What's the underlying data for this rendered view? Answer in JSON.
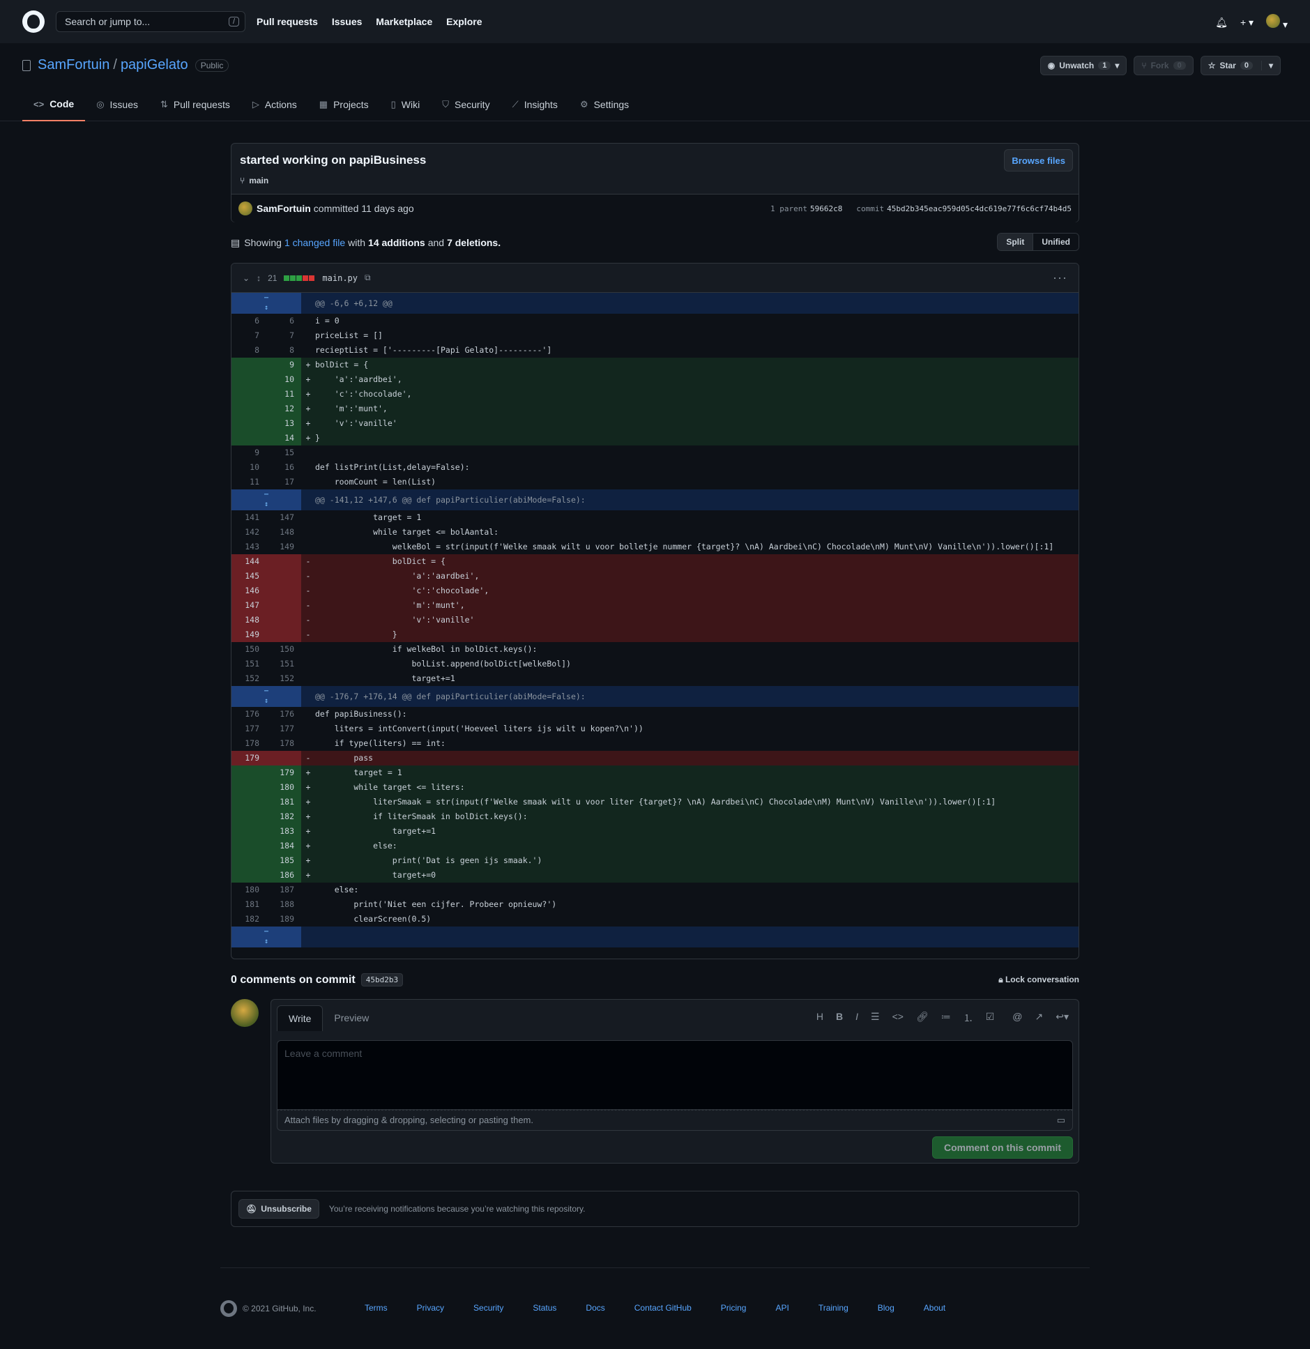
{
  "header": {
    "search_placeholder": "Search or jump to...",
    "search_key": "/",
    "nav": [
      "Pull requests",
      "Issues",
      "Marketplace",
      "Explore"
    ]
  },
  "repo": {
    "owner": "SamFortuin",
    "name": "papiGelato",
    "visibility": "Public",
    "watch_label": "Unwatch",
    "watch_count": "1",
    "fork_label": "Fork",
    "fork_count": "0",
    "star_label": "Star",
    "star_count": "0",
    "tabs": [
      {
        "label": "Code",
        "icon": "code-icon"
      },
      {
        "label": "Issues",
        "icon": "issue-icon"
      },
      {
        "label": "Pull requests",
        "icon": "pull-request-icon"
      },
      {
        "label": "Actions",
        "icon": "play-icon"
      },
      {
        "label": "Projects",
        "icon": "project-icon"
      },
      {
        "label": "Wiki",
        "icon": "book-icon"
      },
      {
        "label": "Security",
        "icon": "shield-icon"
      },
      {
        "label": "Insights",
        "icon": "graph-icon"
      },
      {
        "label": "Settings",
        "icon": "gear-icon"
      }
    ]
  },
  "commit": {
    "title": "started working on papiBusiness",
    "branch": "main",
    "browse_label": "Browse files",
    "author": "SamFortuin",
    "action": "committed",
    "when": "11 days ago",
    "parent_label": "1 parent",
    "parent_sha": "59662c8",
    "commit_label": "commit",
    "sha": "45bd2b345eac959d05c4dc619e77f6c6cf74b4d5"
  },
  "summary": {
    "showing": "Showing",
    "changed": "1 changed file",
    "with": "with",
    "additions": "14 additions",
    "and": "and",
    "deletions": "7 deletions.",
    "split": "Split",
    "unified": "Unified"
  },
  "file": {
    "change_count": "21",
    "name": "main.py"
  },
  "diff_lines": [
    {
      "t": "hunk",
      "code": "@@ -6,6 +6,12 @@"
    },
    {
      "t": "ctx",
      "o": "6",
      "n": "6",
      "code": "i = 0"
    },
    {
      "t": "ctx",
      "o": "7",
      "n": "7",
      "code": "priceList = []"
    },
    {
      "t": "ctx",
      "o": "8",
      "n": "8",
      "code": "recieptList = ['---------[Papi Gelato]---------']"
    },
    {
      "t": "add",
      "o": "",
      "n": "9",
      "code": "bolDict = {"
    },
    {
      "t": "add",
      "o": "",
      "n": "10",
      "code": "    'a':'aardbei',"
    },
    {
      "t": "add",
      "o": "",
      "n": "11",
      "code": "    'c':'chocolade',"
    },
    {
      "t": "add",
      "o": "",
      "n": "12",
      "code": "    'm':'munt',"
    },
    {
      "t": "add",
      "o": "",
      "n": "13",
      "code": "    'v':'vanille'"
    },
    {
      "t": "add",
      "o": "",
      "n": "14",
      "code": "}"
    },
    {
      "t": "ctx",
      "o": "9",
      "n": "15",
      "code": ""
    },
    {
      "t": "ctx",
      "o": "10",
      "n": "16",
      "code": "def listPrint(List,delay=False):"
    },
    {
      "t": "ctx",
      "o": "11",
      "n": "17",
      "code": "    roomCount = len(List)"
    },
    {
      "t": "hunk",
      "code": "@@ -141,12 +147,6 @@ def papiParticulier(abiMode=False):"
    },
    {
      "t": "ctx",
      "o": "141",
      "n": "147",
      "code": "            target = 1"
    },
    {
      "t": "ctx",
      "o": "142",
      "n": "148",
      "code": "            while target <= bolAantal:"
    },
    {
      "t": "ctx",
      "o": "143",
      "n": "149",
      "code": "                welkeBol = str(input(f'Welke smaak wilt u voor bolletje nummer {target}? \\nA) Aardbei\\nC) Chocolade\\nM) Munt\\nV) Vanille\\n')).lower()[:1]"
    },
    {
      "t": "del",
      "o": "144",
      "n": "",
      "code": "                bolDict = {"
    },
    {
      "t": "del",
      "o": "145",
      "n": "",
      "code": "                    'a':'aardbei',"
    },
    {
      "t": "del",
      "o": "146",
      "n": "",
      "code": "                    'c':'chocolade',"
    },
    {
      "t": "del",
      "o": "147",
      "n": "",
      "code": "                    'm':'munt',"
    },
    {
      "t": "del",
      "o": "148",
      "n": "",
      "code": "                    'v':'vanille'"
    },
    {
      "t": "del",
      "o": "149",
      "n": "",
      "code": "                }"
    },
    {
      "t": "ctx",
      "o": "150",
      "n": "150",
      "code": "                if welkeBol in bolDict.keys():"
    },
    {
      "t": "ctx",
      "o": "151",
      "n": "151",
      "code": "                    bolList.append(bolDict[welkeBol])"
    },
    {
      "t": "ctx",
      "o": "152",
      "n": "152",
      "code": "                    target+=1"
    },
    {
      "t": "hunk",
      "code": "@@ -176,7 +176,14 @@ def papiParticulier(abiMode=False):"
    },
    {
      "t": "ctx",
      "o": "176",
      "n": "176",
      "code": "def papiBusiness():"
    },
    {
      "t": "ctx",
      "o": "177",
      "n": "177",
      "code": "    liters = intConvert(input('Hoeveel liters ijs wilt u kopen?\\n'))"
    },
    {
      "t": "ctx",
      "o": "178",
      "n": "178",
      "code": "    if type(liters) == int:"
    },
    {
      "t": "del",
      "o": "179",
      "n": "",
      "code": "        pass"
    },
    {
      "t": "add",
      "o": "",
      "n": "179",
      "code": "        target = 1"
    },
    {
      "t": "add",
      "o": "",
      "n": "180",
      "code": "        while target <= liters:"
    },
    {
      "t": "add",
      "o": "",
      "n": "181",
      "code": "            literSmaak = str(input(f'Welke smaak wilt u voor liter {target}? \\nA) Aardbei\\nC) Chocolade\\nM) Munt\\nV) Vanille\\n')).lower()[:1]"
    },
    {
      "t": "add",
      "o": "",
      "n": "182",
      "code": "            if literSmaak in bolDict.keys():"
    },
    {
      "t": "add",
      "o": "",
      "n": "183",
      "code": "                target+=1"
    },
    {
      "t": "add",
      "o": "",
      "n": "184",
      "code": "            else:"
    },
    {
      "t": "add",
      "o": "",
      "n": "185",
      "code": "                print('Dat is geen ijs smaak.')"
    },
    {
      "t": "add",
      "o": "",
      "n": "186",
      "code": "                target+=0"
    },
    {
      "t": "ctx",
      "o": "180",
      "n": "187",
      "code": "    else:"
    },
    {
      "t": "ctx",
      "o": "181",
      "n": "188",
      "code": "        print('Niet een cijfer. Probeer opnieuw?')"
    },
    {
      "t": "ctx",
      "o": "182",
      "n": "189",
      "code": "        clearScreen(0.5)"
    },
    {
      "t": "hunk",
      "code": ""
    }
  ],
  "comments": {
    "title": "0 comments on commit",
    "sha_short": "45bd2b3",
    "lock_label": "Lock conversation",
    "write_tab": "Write",
    "preview_tab": "Preview",
    "placeholder": "Leave a comment",
    "attach_text": "Attach files by dragging & dropping, selecting or pasting them.",
    "submit_label": "Comment on this commit"
  },
  "notifications": {
    "button": "Unsubscribe",
    "text": "You’re receiving notifications because you’re watching this repository."
  },
  "footer": {
    "copyright": "© 2021 GitHub, Inc.",
    "links": [
      "Terms",
      "Privacy",
      "Security",
      "Status",
      "Docs",
      "Contact GitHub",
      "Pricing",
      "API",
      "Training",
      "Blog",
      "About"
    ]
  },
  "colors": {
    "bg": "#0d1117",
    "accent": "#58a6ff",
    "add_bg": "#12261e",
    "del_bg": "#3d1518",
    "tab_underline": "#f78166"
  }
}
